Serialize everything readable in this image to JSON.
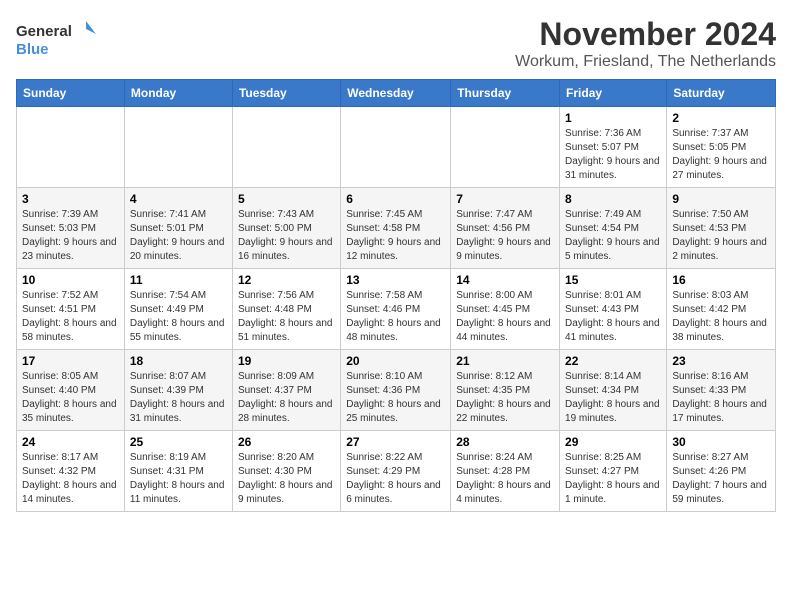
{
  "logo": {
    "line1": "General",
    "line2": "Blue"
  },
  "title": "November 2024",
  "location": "Workum, Friesland, The Netherlands",
  "days_of_week": [
    "Sunday",
    "Monday",
    "Tuesday",
    "Wednesday",
    "Thursday",
    "Friday",
    "Saturday"
  ],
  "weeks": [
    [
      {
        "day": "",
        "info": ""
      },
      {
        "day": "",
        "info": ""
      },
      {
        "day": "",
        "info": ""
      },
      {
        "day": "",
        "info": ""
      },
      {
        "day": "",
        "info": ""
      },
      {
        "day": "1",
        "info": "Sunrise: 7:36 AM\nSunset: 5:07 PM\nDaylight: 9 hours and 31 minutes."
      },
      {
        "day": "2",
        "info": "Sunrise: 7:37 AM\nSunset: 5:05 PM\nDaylight: 9 hours and 27 minutes."
      }
    ],
    [
      {
        "day": "3",
        "info": "Sunrise: 7:39 AM\nSunset: 5:03 PM\nDaylight: 9 hours and 23 minutes."
      },
      {
        "day": "4",
        "info": "Sunrise: 7:41 AM\nSunset: 5:01 PM\nDaylight: 9 hours and 20 minutes."
      },
      {
        "day": "5",
        "info": "Sunrise: 7:43 AM\nSunset: 5:00 PM\nDaylight: 9 hours and 16 minutes."
      },
      {
        "day": "6",
        "info": "Sunrise: 7:45 AM\nSunset: 4:58 PM\nDaylight: 9 hours and 12 minutes."
      },
      {
        "day": "7",
        "info": "Sunrise: 7:47 AM\nSunset: 4:56 PM\nDaylight: 9 hours and 9 minutes."
      },
      {
        "day": "8",
        "info": "Sunrise: 7:49 AM\nSunset: 4:54 PM\nDaylight: 9 hours and 5 minutes."
      },
      {
        "day": "9",
        "info": "Sunrise: 7:50 AM\nSunset: 4:53 PM\nDaylight: 9 hours and 2 minutes."
      }
    ],
    [
      {
        "day": "10",
        "info": "Sunrise: 7:52 AM\nSunset: 4:51 PM\nDaylight: 8 hours and 58 minutes."
      },
      {
        "day": "11",
        "info": "Sunrise: 7:54 AM\nSunset: 4:49 PM\nDaylight: 8 hours and 55 minutes."
      },
      {
        "day": "12",
        "info": "Sunrise: 7:56 AM\nSunset: 4:48 PM\nDaylight: 8 hours and 51 minutes."
      },
      {
        "day": "13",
        "info": "Sunrise: 7:58 AM\nSunset: 4:46 PM\nDaylight: 8 hours and 48 minutes."
      },
      {
        "day": "14",
        "info": "Sunrise: 8:00 AM\nSunset: 4:45 PM\nDaylight: 8 hours and 44 minutes."
      },
      {
        "day": "15",
        "info": "Sunrise: 8:01 AM\nSunset: 4:43 PM\nDaylight: 8 hours and 41 minutes."
      },
      {
        "day": "16",
        "info": "Sunrise: 8:03 AM\nSunset: 4:42 PM\nDaylight: 8 hours and 38 minutes."
      }
    ],
    [
      {
        "day": "17",
        "info": "Sunrise: 8:05 AM\nSunset: 4:40 PM\nDaylight: 8 hours and 35 minutes."
      },
      {
        "day": "18",
        "info": "Sunrise: 8:07 AM\nSunset: 4:39 PM\nDaylight: 8 hours and 31 minutes."
      },
      {
        "day": "19",
        "info": "Sunrise: 8:09 AM\nSunset: 4:37 PM\nDaylight: 8 hours and 28 minutes."
      },
      {
        "day": "20",
        "info": "Sunrise: 8:10 AM\nSunset: 4:36 PM\nDaylight: 8 hours and 25 minutes."
      },
      {
        "day": "21",
        "info": "Sunrise: 8:12 AM\nSunset: 4:35 PM\nDaylight: 8 hours and 22 minutes."
      },
      {
        "day": "22",
        "info": "Sunrise: 8:14 AM\nSunset: 4:34 PM\nDaylight: 8 hours and 19 minutes."
      },
      {
        "day": "23",
        "info": "Sunrise: 8:16 AM\nSunset: 4:33 PM\nDaylight: 8 hours and 17 minutes."
      }
    ],
    [
      {
        "day": "24",
        "info": "Sunrise: 8:17 AM\nSunset: 4:32 PM\nDaylight: 8 hours and 14 minutes."
      },
      {
        "day": "25",
        "info": "Sunrise: 8:19 AM\nSunset: 4:31 PM\nDaylight: 8 hours and 11 minutes."
      },
      {
        "day": "26",
        "info": "Sunrise: 8:20 AM\nSunset: 4:30 PM\nDaylight: 8 hours and 9 minutes."
      },
      {
        "day": "27",
        "info": "Sunrise: 8:22 AM\nSunset: 4:29 PM\nDaylight: 8 hours and 6 minutes."
      },
      {
        "day": "28",
        "info": "Sunrise: 8:24 AM\nSunset: 4:28 PM\nDaylight: 8 hours and 4 minutes."
      },
      {
        "day": "29",
        "info": "Sunrise: 8:25 AM\nSunset: 4:27 PM\nDaylight: 8 hours and 1 minute."
      },
      {
        "day": "30",
        "info": "Sunrise: 8:27 AM\nSunset: 4:26 PM\nDaylight: 7 hours and 59 minutes."
      }
    ]
  ]
}
